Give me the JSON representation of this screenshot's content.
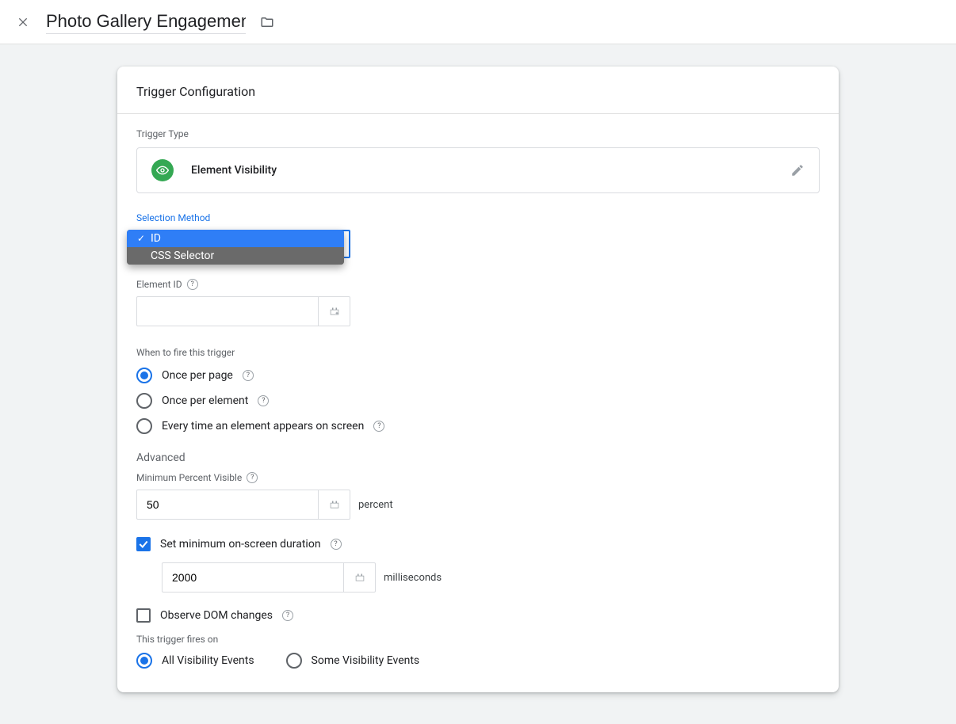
{
  "header": {
    "title": "Photo Gallery Engagements"
  },
  "card": {
    "title": "Trigger Configuration",
    "trigger_type_label": "Trigger Type",
    "trigger_type_value": "Element Visibility",
    "selection_method": {
      "label": "Selection Method",
      "value": "ID",
      "options": [
        "ID",
        "CSS Selector"
      ]
    },
    "element_id": {
      "label": "Element ID",
      "value": ""
    },
    "when_fire_label": "When to fire this trigger",
    "when_fire_options": {
      "once_page": "Once per page",
      "once_element": "Once per element",
      "every_time": "Every time an element appears on screen"
    },
    "when_fire_selected": "once_page",
    "advanced_label": "Advanced",
    "min_percent": {
      "label": "Minimum Percent Visible",
      "value": "50",
      "unit": "percent"
    },
    "min_duration": {
      "label": "Set minimum on-screen duration",
      "checked": true,
      "value": "2000",
      "unit": "milliseconds"
    },
    "observe_dom": {
      "label": "Observe DOM changes",
      "checked": false
    },
    "fires_on": {
      "label": "This trigger fires on",
      "options": {
        "all": "All Visibility Events",
        "some": "Some Visibility Events"
      },
      "selected": "all"
    }
  }
}
